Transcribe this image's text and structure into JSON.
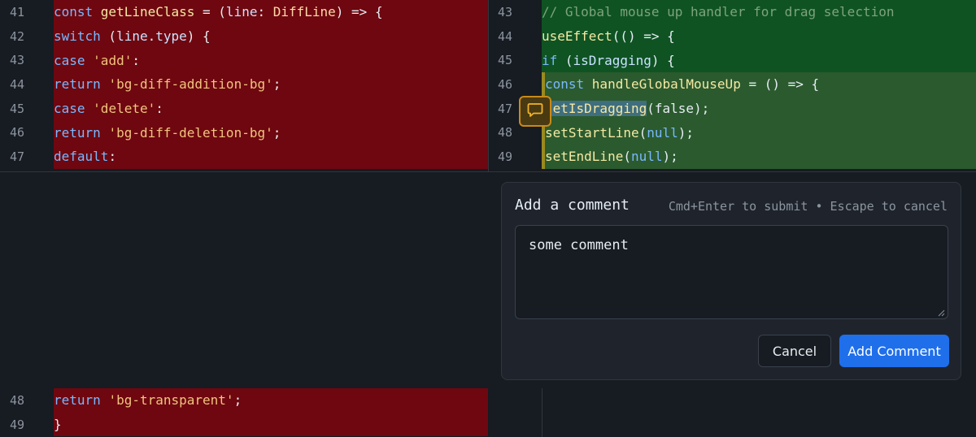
{
  "left_top": [
    {
      "num": "41",
      "indent": "    ",
      "tokens": [
        [
          "kw",
          "const "
        ],
        [
          "fn",
          "getLineClass"
        ],
        [
          "pl",
          " = ("
        ],
        [
          "var",
          "line"
        ],
        [
          "pl",
          ": "
        ],
        [
          "type",
          "DiffLine"
        ],
        [
          "pl",
          ") => {"
        ]
      ]
    },
    {
      "num": "42",
      "indent": "      ",
      "tokens": [
        [
          "kw",
          "switch"
        ],
        [
          "pl",
          " ("
        ],
        [
          "var",
          "line"
        ],
        [
          "pl",
          "."
        ],
        [
          "var",
          "type"
        ],
        [
          "pl",
          ") {"
        ]
      ]
    },
    {
      "num": "43",
      "indent": "        ",
      "tokens": [
        [
          "kw",
          "case "
        ],
        [
          "str",
          "'add'"
        ],
        [
          "pl",
          ":"
        ]
      ]
    },
    {
      "num": "44",
      "indent": "          ",
      "tokens": [
        [
          "kw",
          "return "
        ],
        [
          "str",
          "'bg-diff-addition-bg'"
        ],
        [
          "pl",
          ";"
        ]
      ]
    },
    {
      "num": "45",
      "indent": "        ",
      "tokens": [
        [
          "kw",
          "case "
        ],
        [
          "str",
          "'delete'"
        ],
        [
          "pl",
          ":"
        ]
      ]
    },
    {
      "num": "46",
      "indent": "          ",
      "tokens": [
        [
          "kw",
          "return "
        ],
        [
          "str",
          "'bg-diff-deletion-bg'"
        ],
        [
          "pl",
          ";"
        ]
      ]
    },
    {
      "num": "47",
      "indent": "        ",
      "tokens": [
        [
          "kw",
          "default"
        ],
        [
          "pl",
          ":"
        ]
      ]
    }
  ],
  "right_top": [
    {
      "num": "43",
      "style": "add-dark",
      "indent": "    ",
      "tokens": [
        [
          "com",
          "// Global mouse up handler for drag selection"
        ]
      ]
    },
    {
      "num": "44",
      "style": "add-dark",
      "indent": "    ",
      "tokens": [
        [
          "fn",
          "useEffect"
        ],
        [
          "pl",
          "(() => {"
        ]
      ]
    },
    {
      "num": "45",
      "style": "add-dark",
      "indent": "      ",
      "tokens": [
        [
          "kw",
          "if"
        ],
        [
          "pl",
          " ("
        ],
        [
          "var",
          "isDragging"
        ],
        [
          "pl",
          ") {"
        ]
      ]
    },
    {
      "num": "46",
      "style": "add-light",
      "indent": "       ",
      "tokens": [
        [
          "kw",
          "const "
        ],
        [
          "fn",
          "handleGlobalMouseUp"
        ],
        [
          "pl",
          " = () => {"
        ]
      ]
    },
    {
      "num": "47",
      "style": "add-light",
      "indent": "         ",
      "tokens": [
        [
          "fn",
          "setIsDragging",
          "sel"
        ],
        [
          "pl",
          "(false);"
        ]
      ]
    },
    {
      "num": "48",
      "style": "add-light",
      "indent": "         ",
      "tokens": [
        [
          "fn",
          "setStartLine"
        ],
        [
          "pl",
          "("
        ],
        [
          "nul",
          "null"
        ],
        [
          "pl",
          ");"
        ]
      ]
    },
    {
      "num": "49",
      "style": "add-light",
      "indent": "         ",
      "tokens": [
        [
          "fn",
          "setEndLine"
        ],
        [
          "pl",
          "("
        ],
        [
          "nul",
          "null"
        ],
        [
          "pl",
          ");"
        ]
      ]
    }
  ],
  "left_bottom": [
    {
      "num": "48",
      "indent": "          ",
      "tokens": [
        [
          "kw",
          "return "
        ],
        [
          "str",
          "'bg-transparent'"
        ],
        [
          "pl",
          ";"
        ]
      ]
    },
    {
      "num": "49",
      "indent": "      ",
      "tokens": [
        [
          "pl",
          "}"
        ]
      ]
    }
  ],
  "comment_dialog": {
    "title": "Add a comment",
    "hint": "Cmd+Enter to submit • Escape to cancel",
    "value": "some comment",
    "cancel_label": "Cancel",
    "submit_label": "Add Comment"
  },
  "icons": {
    "comment_button": "comment-icon"
  },
  "colors": {
    "deletion": "#6e070f",
    "addition": "#0f5323",
    "addition_hunk": "#2b5a2e",
    "accent": "#1f6feb",
    "comment_button_border": "#c98a18"
  }
}
